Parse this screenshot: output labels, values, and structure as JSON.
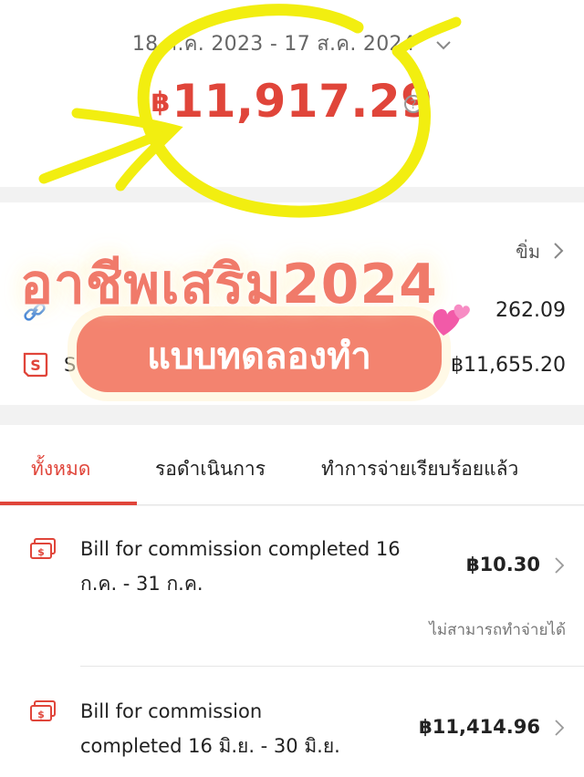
{
  "header": {
    "date_range": "18 ส.ค. 2023 - 17 ส.ค. 2024",
    "total_currency": "฿",
    "total_amount": "11,917.29"
  },
  "summary": {
    "more_label": "ขิ่ม",
    "rows": [
      {
        "icon": "link-icon",
        "amount": "262.09"
      },
      {
        "icon": "shopee-icon",
        "label": "S",
        "amount": "฿11,655.20"
      }
    ]
  },
  "tabs": [
    {
      "label": "ทั้งหมด",
      "active": true
    },
    {
      "label": "รอดำเนินการ",
      "active": false
    },
    {
      "label": "ทำการจ่ายเรียบร้อยแล้ว",
      "active": false
    }
  ],
  "bills": [
    {
      "title_line1": "Bill for commission completed 16",
      "title_line2": "ก.ค. - 31 ก.ค.",
      "amount": "฿10.30",
      "note": "ไม่สามารถทำจ่ายได้"
    },
    {
      "title_line1": "Bill for commission",
      "title_line2": "completed 16 มิ.ย. - 30 มิ.ย.",
      "amount": "฿11,414.96"
    }
  ],
  "overlay": {
    "title": "อาชีพเสริม2024",
    "subtitle": "แบบทดลองทำ"
  },
  "colors": {
    "accent": "#e0453a",
    "highlighter": "#f2ee10",
    "sticker": "#f3836f"
  }
}
